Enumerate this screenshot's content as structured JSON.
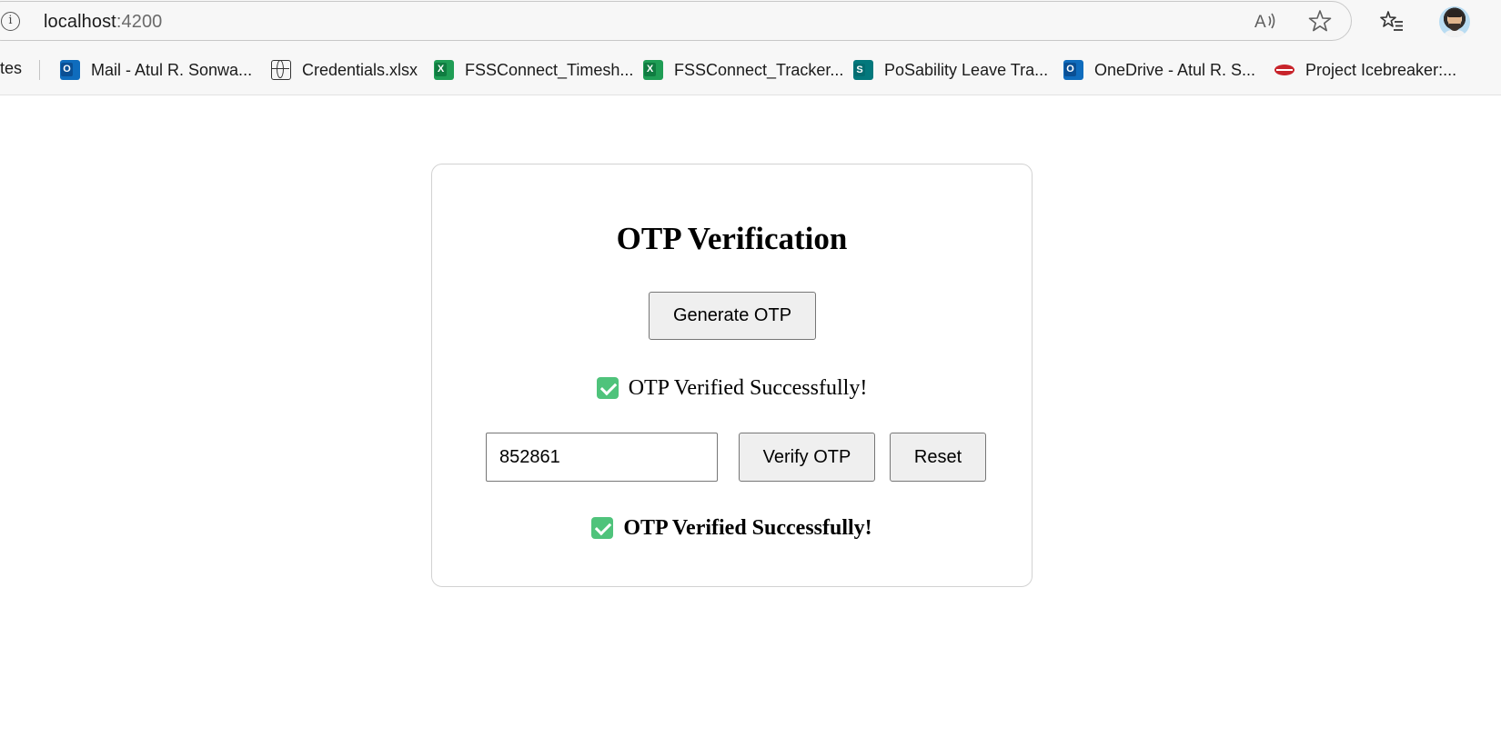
{
  "browser": {
    "url_host": "localhost",
    "url_port": ":4200",
    "icons": [
      "info-icon",
      "read-aloud-icon",
      "favorite-star-icon",
      "favorites-list-icon",
      "profile-avatar"
    ]
  },
  "bookmarks": {
    "partial_first": "tes",
    "items": [
      {
        "label": "Mail - Atul R. Sonwa...",
        "icon": "outlook-icon"
      },
      {
        "label": "Credentials.xlsx",
        "icon": "globe-icon"
      },
      {
        "label": "FSSConnect_Timesh...",
        "icon": "excel-icon"
      },
      {
        "label": "FSSConnect_Tracker...",
        "icon": "excel-icon"
      },
      {
        "label": "PoSability Leave Tra...",
        "icon": "sharepoint-icon"
      },
      {
        "label": "OneDrive - Atul R. S...",
        "icon": "outlook-icon"
      },
      {
        "label": "Project Icebreaker:...",
        "icon": "lips-icon"
      }
    ]
  },
  "otp": {
    "title": "OTP Verification",
    "generate_label": "Generate OTP",
    "status_generated": "OTP Verified Successfully!",
    "input_value": "852861",
    "verify_label": "Verify OTP",
    "reset_label": "Reset",
    "status_verified": "OTP Verified Successfully!"
  },
  "colors": {
    "check_green": "#4fc37b",
    "button_bg": "#efefef"
  }
}
